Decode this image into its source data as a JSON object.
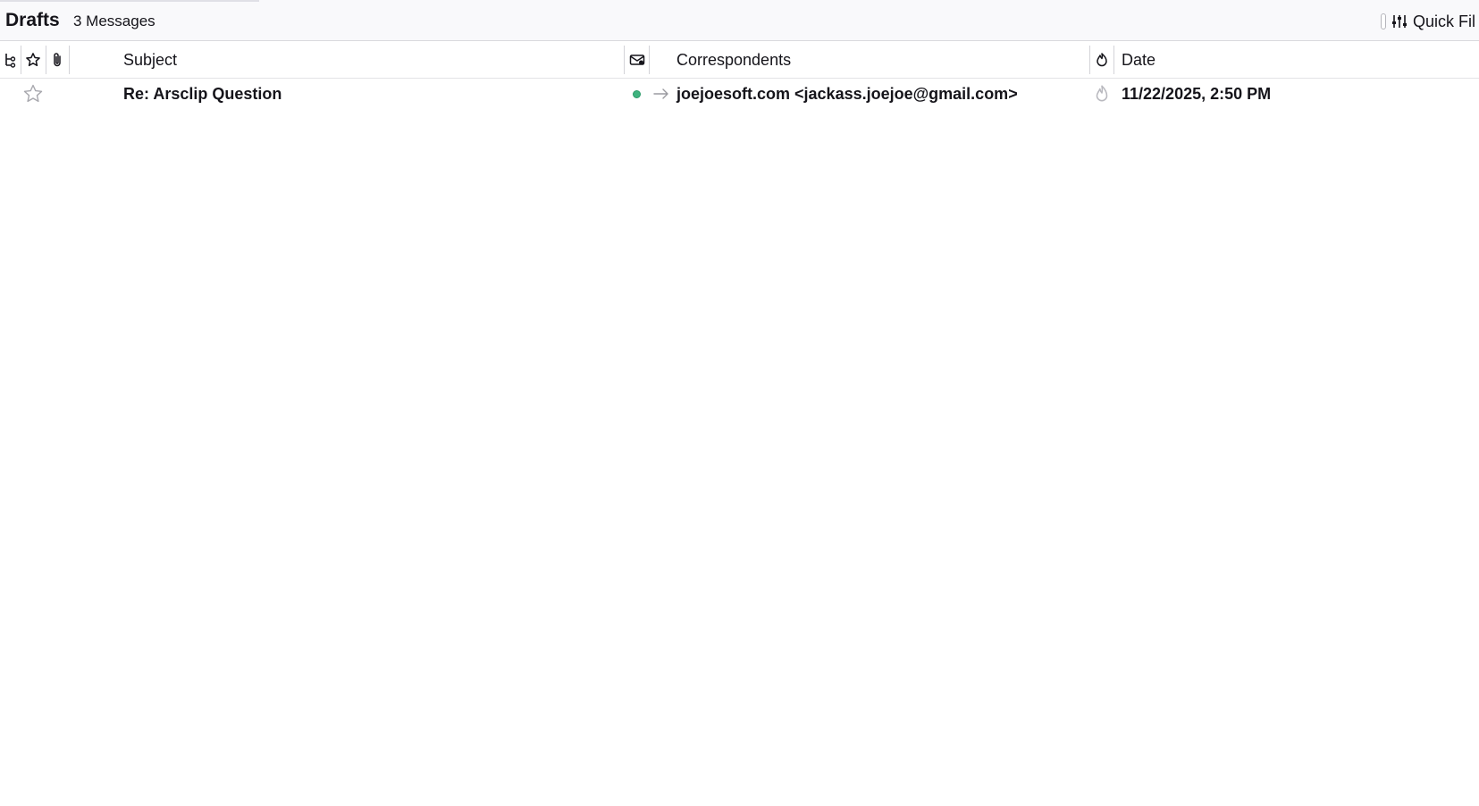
{
  "header": {
    "folder_name": "Drafts",
    "message_count": "3 Messages",
    "quick_filter_label": "Quick Fil"
  },
  "columns": {
    "thread_icon": "thread-icon",
    "star_icon": "star-icon",
    "attachment_icon": "paperclip-icon",
    "subject": "Subject",
    "read_status_icon": "read-status-icon",
    "correspondents": "Correspondents",
    "junk_icon": "junk-status-icon",
    "date": "Date"
  },
  "messages": [
    {
      "subject": "Re: Arsclip Question",
      "correspondents": "joejoesoft.com <jackass.joejoe@gmail.com>",
      "date": "11/22/2025, 2:50 PM",
      "starred": false,
      "unread": true
    }
  ],
  "colors": {
    "accent_unread": "#3fb37f",
    "header_bg": "#f9f9fb",
    "text": "#15141a"
  }
}
